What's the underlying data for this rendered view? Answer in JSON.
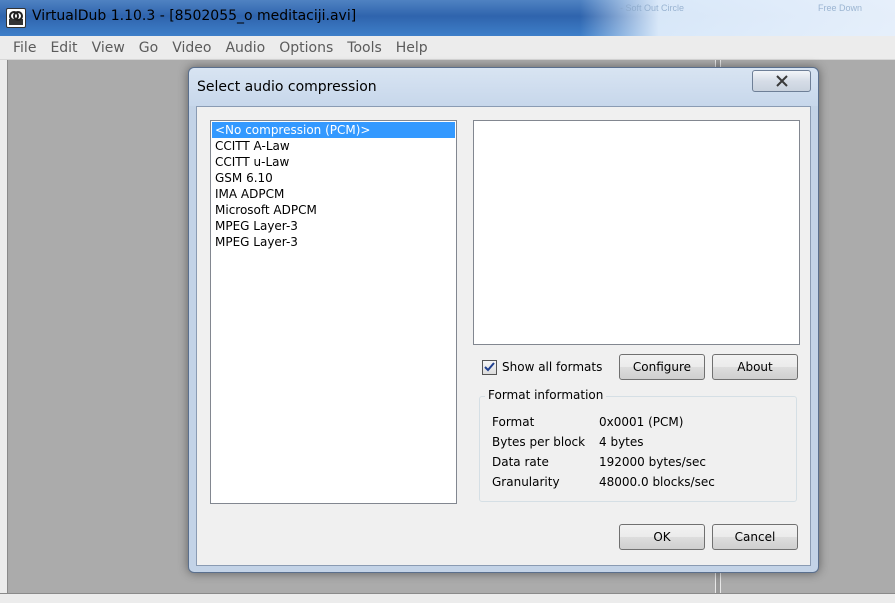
{
  "window": {
    "title": "VirtualDub 1.10.3 - [8502055_o meditaciji.avi]",
    "background_hint_left": "- Soft Out Circle",
    "background_hint_right": "Free Down"
  },
  "menu": {
    "items": [
      {
        "label": "File"
      },
      {
        "label": "Edit"
      },
      {
        "label": "View"
      },
      {
        "label": "Go"
      },
      {
        "label": "Video"
      },
      {
        "label": "Audio"
      },
      {
        "label": "Options"
      },
      {
        "label": "Tools"
      },
      {
        "label": "Help"
      }
    ]
  },
  "dialog": {
    "title": "Select audio compression",
    "codecs": [
      {
        "label": "<No compression (PCM)>",
        "selected": true
      },
      {
        "label": "CCITT A-Law",
        "selected": false
      },
      {
        "label": "CCITT u-Law",
        "selected": false
      },
      {
        "label": "GSM 6.10",
        "selected": false
      },
      {
        "label": "IMA ADPCM",
        "selected": false
      },
      {
        "label": "Microsoft ADPCM",
        "selected": false
      },
      {
        "label": "MPEG Layer-3",
        "selected": false
      },
      {
        "label": "MPEG Layer-3",
        "selected": false
      }
    ],
    "show_all_formats": {
      "label": "Show all formats",
      "checked": true
    },
    "configure_label": "Configure",
    "about_label": "About",
    "format_info": {
      "title": "Format information",
      "rows": [
        {
          "label": "Format",
          "value": "0x0001 (PCM)"
        },
        {
          "label": "Bytes per block",
          "value": "4 bytes"
        },
        {
          "label": "Data rate",
          "value": "192000 bytes/sec"
        },
        {
          "label": "Granularity",
          "value": "48000.0 blocks/sec"
        }
      ]
    },
    "ok_label": "OK",
    "cancel_label": "Cancel"
  },
  "colors": {
    "selection": "#3399ff",
    "dialog_frame": "#c3d3e7",
    "workspace": "#ababab"
  }
}
